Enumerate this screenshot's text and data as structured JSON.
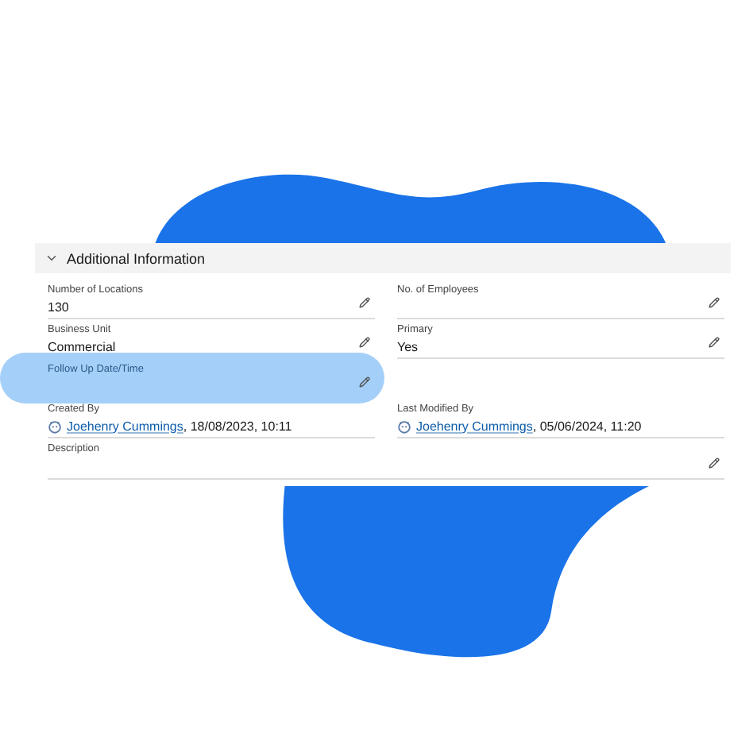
{
  "section": {
    "title": "Additional Information",
    "expanded": true
  },
  "rows": [
    {
      "cells": [
        {
          "kind": "text",
          "label": "Number of Locations",
          "value": "130",
          "editable": true,
          "highlighted": false
        },
        {
          "kind": "text",
          "label": "No. of Employees",
          "editable": true,
          "highlighted": false
        }
      ]
    },
    {
      "cells": [
        {
          "kind": "text",
          "label": "Business Unit",
          "value": "Commercial",
          "editable": true,
          "highlighted": false
        },
        {
          "kind": "text",
          "label": "Primary",
          "value": "Yes",
          "editable": true,
          "highlighted": false
        }
      ]
    },
    {
      "cells": [
        {
          "kind": "text",
          "label": "Follow Up Date/Time",
          "editable": true,
          "highlighted": true
        },
        {
          "kind": "blank"
        }
      ]
    },
    {
      "cells": [
        {
          "kind": "user",
          "label": "Created By",
          "user": "Joehenry Cummings",
          "value": ", 18/08/2023, 10:11",
          "editable": false,
          "highlighted": false
        },
        {
          "kind": "user",
          "label": "Last Modified By",
          "user": "Joehenry Cummings",
          "value": ", 05/06/2024, 11:20",
          "editable": false,
          "highlighted": false
        }
      ]
    },
    {
      "cells": [
        {
          "kind": "wide",
          "label": "Description",
          "editable": true,
          "highlighted": false
        }
      ]
    }
  ]
}
